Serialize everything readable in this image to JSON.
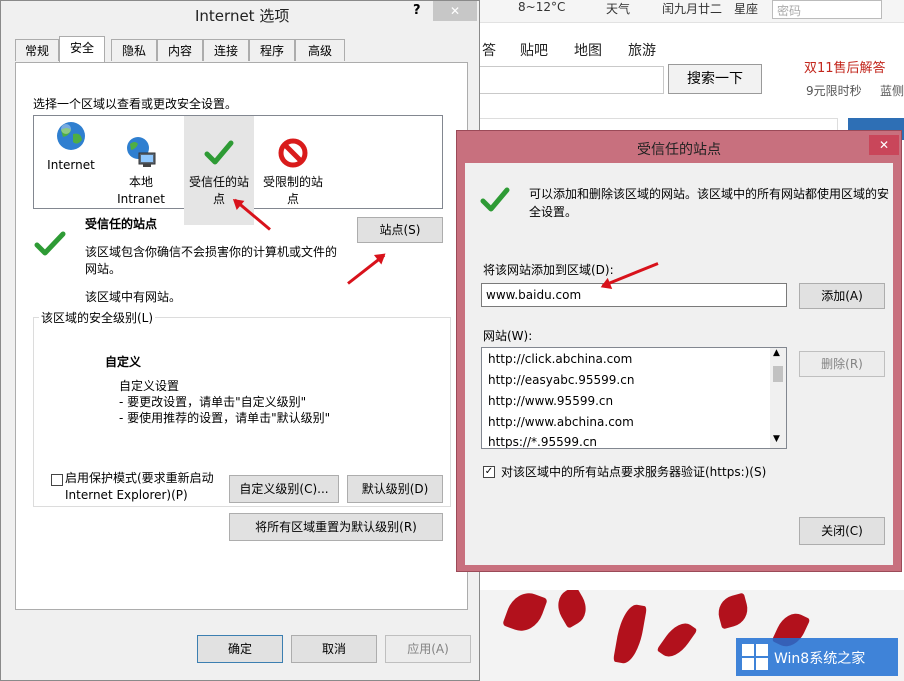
{
  "colors": {
    "accent": "#2d6da3",
    "dialog_frame": "#c8707e",
    "annotation_arrow": "#d8121b",
    "check_green": "#2e9b35",
    "restricted_red": "#d91b1b"
  },
  "background_browser": {
    "weather": "8~12°C",
    "weather_label": "天气",
    "lunar_date": "闰九月廿二",
    "weekday": "星座",
    "password_placeholder": "密码",
    "nav": [
      "答",
      "贴吧",
      "地图",
      "旅游"
    ],
    "search_button": "搜索一下",
    "promo_title": "双11售后解答",
    "promo_sub": "9元限时秒",
    "promo_sub2": "蓝侧"
  },
  "internet_options": {
    "title": "Internet 选项",
    "help": "?",
    "close": "✕",
    "tabs": [
      "常规",
      "安全",
      "隐私",
      "内容",
      "连接",
      "程序",
      "高级"
    ],
    "instruction": "选择一个区域以查看或更改安全设置。",
    "zones": [
      {
        "icon": "globe-icon",
        "label": "Internet"
      },
      {
        "icon": "intranet-icon",
        "label": "本地\nIntranet"
      },
      {
        "icon": "check-icon",
        "label": "受信任的站\n点"
      },
      {
        "icon": "restricted-icon",
        "label": "受限制的站\n点"
      }
    ],
    "selected_zone_title": "受信任的站点",
    "selected_zone_desc": "该区域包含你确信不会损害你的计算机或文件的网站。",
    "selected_zone_note": "该区域中有网站。",
    "sites_button": "站点(S)",
    "security_level_group": "该区域的安全级别(L)",
    "custom_title": "自定义",
    "custom_line1": "自定义设置",
    "custom_line2": "- 要更改设置，请单击\"自定义级别\"",
    "custom_line3": "- 要使用推荐的设置，请单击\"默认级别\"",
    "protected_mode_label": "启用保护模式(要求重新启动 Internet Explorer)(P)",
    "custom_level_button": "自定义级别(C)...",
    "default_level_button": "默认级别(D)",
    "reset_all_button": "将所有区域重置为默认级别(R)",
    "ok_button": "确定",
    "cancel_button": "取消",
    "apply_button": "应用(A)"
  },
  "trusted_sites": {
    "title": "受信任的站点",
    "close": "✕",
    "info": "可以添加和删除该区域的网站。该区域中的所有网站都使用区域的安全设置。",
    "add_label": "将该网站添加到区域(D):",
    "add_value": "www.baidu.com",
    "add_button": "添加(A)",
    "websites_label": "网站(W):",
    "websites": [
      "http://click.abchina.com",
      "http://easyabc.95599.cn",
      "http://www.95599.cn",
      "http://www.abchina.com",
      "https://*.95599.cn"
    ],
    "remove_button": "删除(R)",
    "require_https_label": "对该区域中的所有站点要求服务器验证(https:)(S)",
    "require_https_checked": true,
    "close_button": "关闭(C)"
  },
  "watermark": {
    "text": "Win8系统之家"
  }
}
